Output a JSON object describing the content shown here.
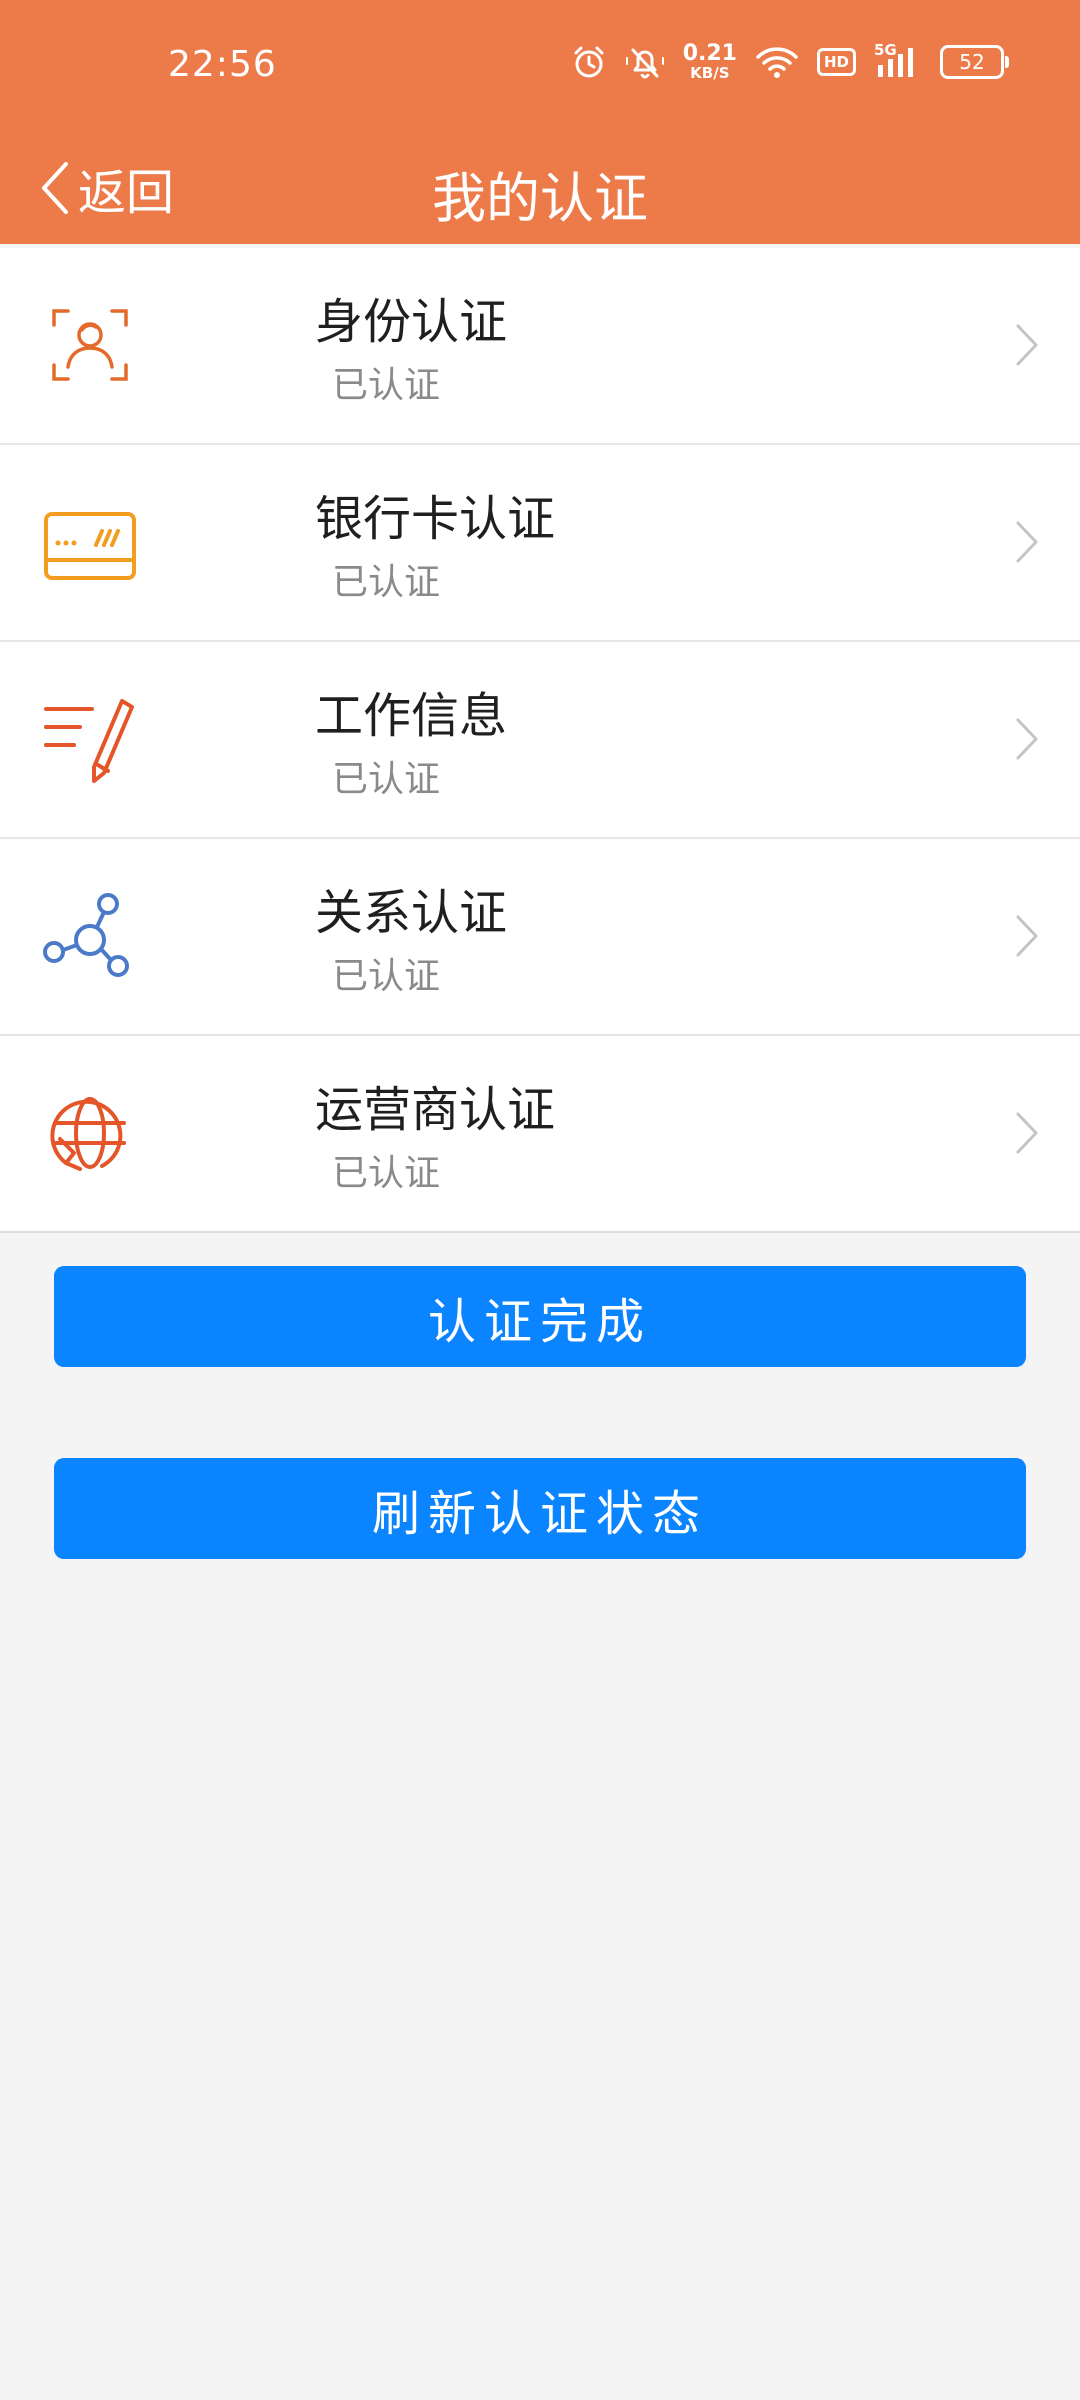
{
  "status_bar": {
    "time": "22:56",
    "net_speed_value": "0.21",
    "net_speed_unit": "KB/S",
    "hd": "HD",
    "network": "5G",
    "battery": "52"
  },
  "nav": {
    "back_label": "返回",
    "title": "我的认证"
  },
  "items": [
    {
      "title": "身份认证",
      "status": "已认证",
      "icon": "face-scan-icon",
      "color": "#e46a2c"
    },
    {
      "title": "银行卡认证",
      "status": "已认证",
      "icon": "bank-card-icon",
      "color": "#f29d1f"
    },
    {
      "title": "工作信息",
      "status": "已认证",
      "icon": "edit-pen-icon",
      "color": "#e4552a"
    },
    {
      "title": "关系认证",
      "status": "已认证",
      "icon": "network-nodes-icon",
      "color": "#4a7ac8"
    },
    {
      "title": "运营商认证",
      "status": "已认证",
      "icon": "globe-phone-icon",
      "color": "#e4552a"
    }
  ],
  "buttons": {
    "complete_label": "认证完成",
    "refresh_label": "刷新认证状态"
  },
  "colors": {
    "header": "#ed7b4a",
    "button": "#0a84ff",
    "background": "#f4f4f4"
  }
}
